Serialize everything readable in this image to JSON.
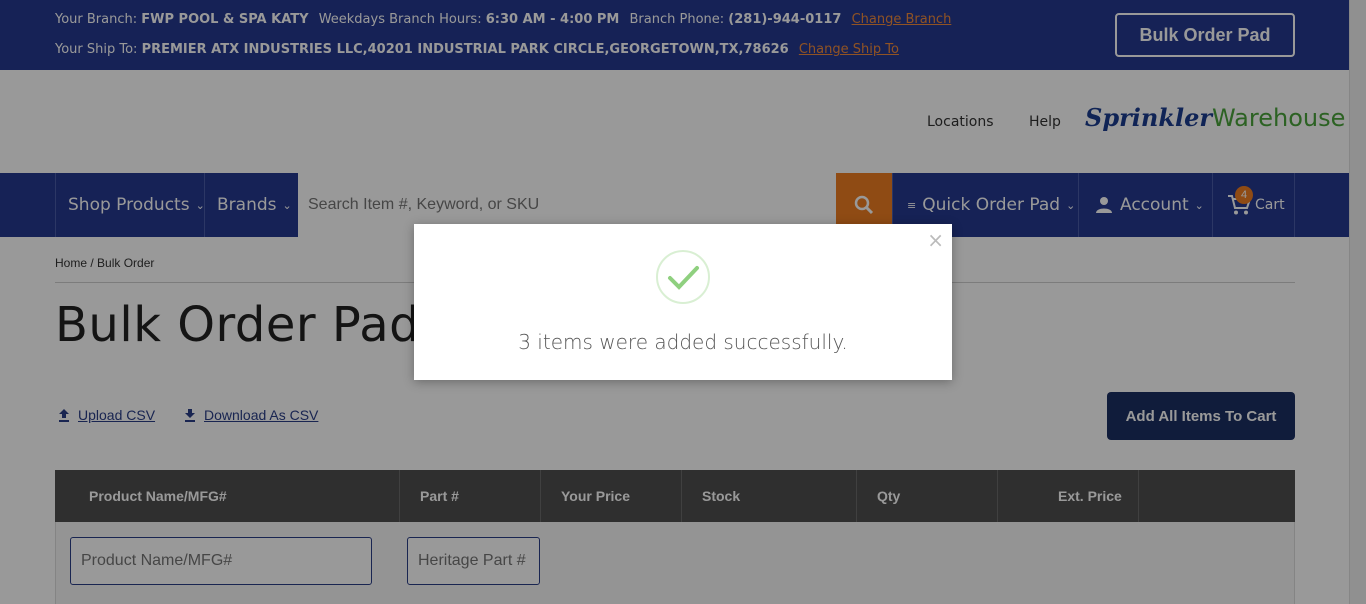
{
  "topbar": {
    "branch_label": "Your Branch:",
    "branch_name": "FWP POOL & SPA KATY",
    "hours_label": "Weekdays Branch Hours:",
    "hours_value": "6:30 AM - 4:00 PM",
    "phone_label": "Branch Phone:",
    "phone_value": "(281)-944-0117",
    "change_branch": "Change Branch",
    "ship_label": "Your Ship To:",
    "ship_value": "PREMIER ATX INDUSTRIES LLC,40201 INDUSTRIAL PARK CIRCLE,GEORGETOWN,TX,78626",
    "change_ship": "Change Ship To",
    "bulk_button": "Bulk Order Pad"
  },
  "header": {
    "locations": "Locations",
    "help": "Help",
    "logo_part1": "Sprinkler",
    "logo_part2": "Warehouse"
  },
  "nav": {
    "shop_products": "Shop Products",
    "brands": "Brands",
    "search_placeholder": "Search Item #, Keyword, or SKU",
    "quick_order": "Quick Order Pad",
    "account": "Account",
    "cart": "Cart",
    "cart_count": "4"
  },
  "breadcrumb": {
    "home": "Home",
    "separator": " / ",
    "current": "Bulk Order"
  },
  "page": {
    "title": "Bulk Order Pad",
    "upload_csv": "Upload CSV",
    "download_csv": "Download As CSV",
    "add_all": "Add All Items To Cart"
  },
  "table": {
    "headers": [
      "Product Name/MFG#",
      "Part #",
      "Your Price",
      "Stock",
      "Qty",
      "Ext. Price"
    ],
    "product_placeholder": "Product Name/MFG#",
    "part_placeholder": "Heritage Part #"
  },
  "modal": {
    "message": "3 items were added successfully.",
    "close": "×"
  },
  "colors": {
    "brand_navy": "#263a8f",
    "accent_orange": "#ee7d22",
    "success_green": "#8fd07f",
    "table_header": "#4f4f4f"
  }
}
